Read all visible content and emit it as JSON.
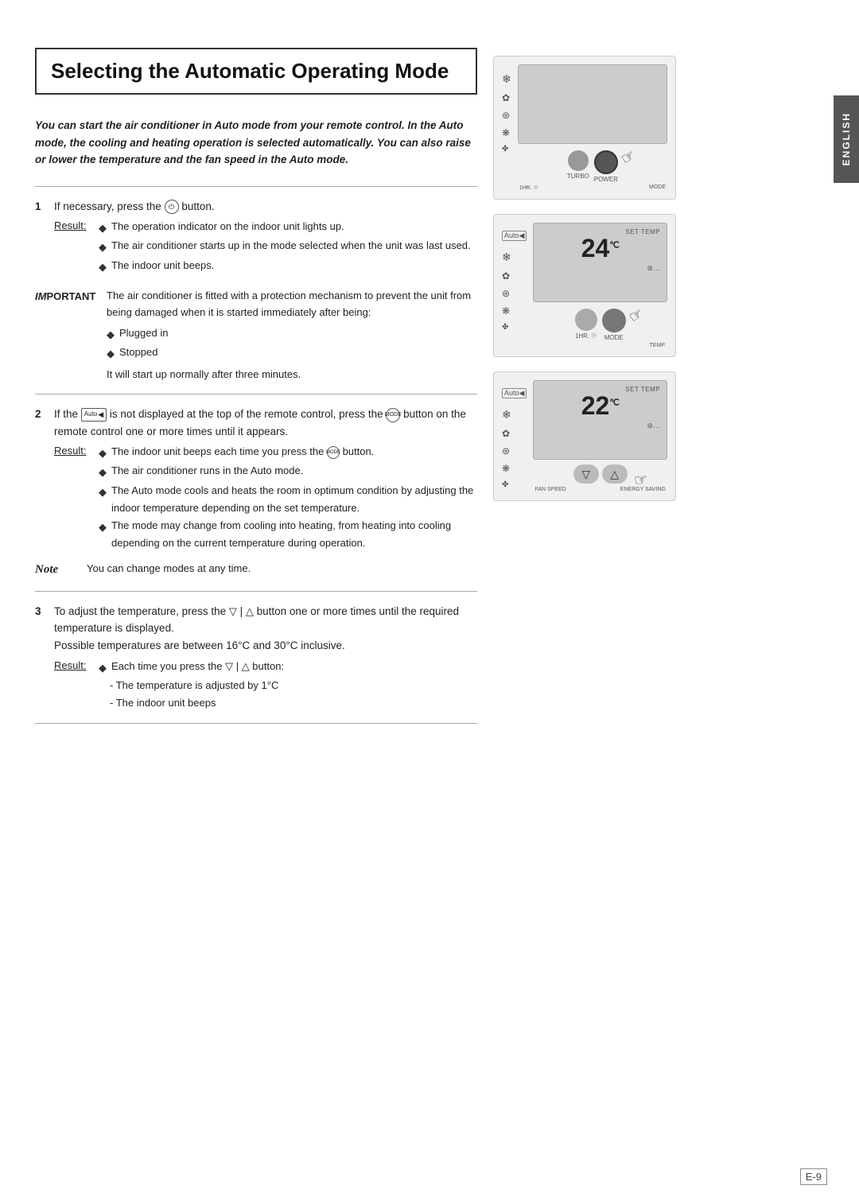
{
  "page": {
    "title": "Selecting the Automatic Operating Mode",
    "page_number": "E-9",
    "language_tab": "ENGLISH"
  },
  "intro": {
    "text": "You can start the air conditioner in Auto mode from your remote control. In the Auto mode, the cooling and heating operation is selected automatically. You can also raise or lower the temperature and the fan speed in the Auto mode."
  },
  "steps": [
    {
      "number": "1",
      "text": "If necessary, press the  button.",
      "button_label": "POWER",
      "result_label": "Result:",
      "result_items": [
        "The operation indicator on the indoor unit lights up.",
        "The air conditioner starts up in the mode selected when the unit was last used.",
        "The indoor unit beeps."
      ]
    },
    {
      "number": "2",
      "text": "If the  is not displayed at the top of the remote control, press the  button on the remote control one or more times until it appears.",
      "result_label": "Result:",
      "result_items": [
        "The indoor unit beeps each time you press the  button.",
        "The air conditioner runs in the Auto mode.",
        "The Auto mode cools and heats the room in optimum condition by adjusting the indoor temperature depending on the set temperature.",
        "The mode may change from cooling into heating, from heating into cooling depending on the current temperature during operation."
      ]
    },
    {
      "number": "3",
      "text": "To adjust the temperature, press the  button one or more times until the required temperature is displayed.",
      "sub_text": "Possible temperatures are between 16°C and 30°C inclusive.",
      "result_label": "Result:",
      "result_items": [
        "Each time you press the  button:",
        "- The temperature is adjusted by 1°C",
        "- The indoor unit beeps"
      ]
    }
  ],
  "important": {
    "label": "IMPORTANT",
    "text": "The air conditioner is fitted with a protection mechanism to prevent the unit from being damaged when it is started immediately after being:",
    "bullets": [
      "Plugged in",
      "Stopped"
    ],
    "footer": "It will start up normally after three minutes."
  },
  "note": {
    "label": "Note",
    "text": "You can change modes at any time."
  },
  "images": [
    {
      "id": "img1",
      "desc": "Remote control showing POWER button highlighted",
      "temp": "",
      "set_temp": "",
      "button": "POWER",
      "labels": [
        "TURBO",
        "POWER",
        "1HR.",
        "MODE"
      ]
    },
    {
      "id": "img2",
      "desc": "Remote control showing MODE button highlighted",
      "temp": "24",
      "set_temp": "SET TEMP",
      "button": "MODE",
      "labels": [
        "1HR.",
        "MODE",
        "TEMP."
      ]
    },
    {
      "id": "img3",
      "desc": "Remote control showing TEMP button highlighted",
      "temp": "22",
      "set_temp": "SET TEMP",
      "button": "TEMP",
      "labels": [
        "FAN SPEED",
        "ENERGY SAVING"
      ]
    }
  ]
}
